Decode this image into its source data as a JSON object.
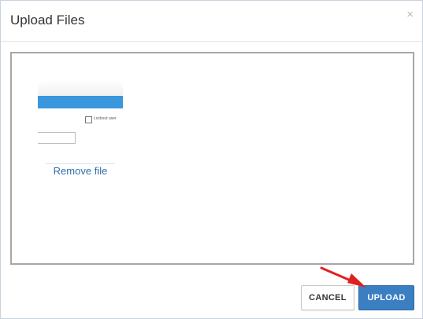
{
  "dialog": {
    "title": "Upload Files",
    "close_label": "×"
  },
  "file": {
    "preview_checkbox_label": "Lockout user",
    "remove_label": "Remove file"
  },
  "footer": {
    "cancel_label": "CANCEL",
    "upload_label": "UPLOAD"
  },
  "colors": {
    "primary": "#3b7fc2",
    "link": "#2e6fb0",
    "annotation_arrow": "#e02020"
  },
  "icons": {
    "close": "close-icon",
    "annotation": "red-arrow-icon"
  }
}
